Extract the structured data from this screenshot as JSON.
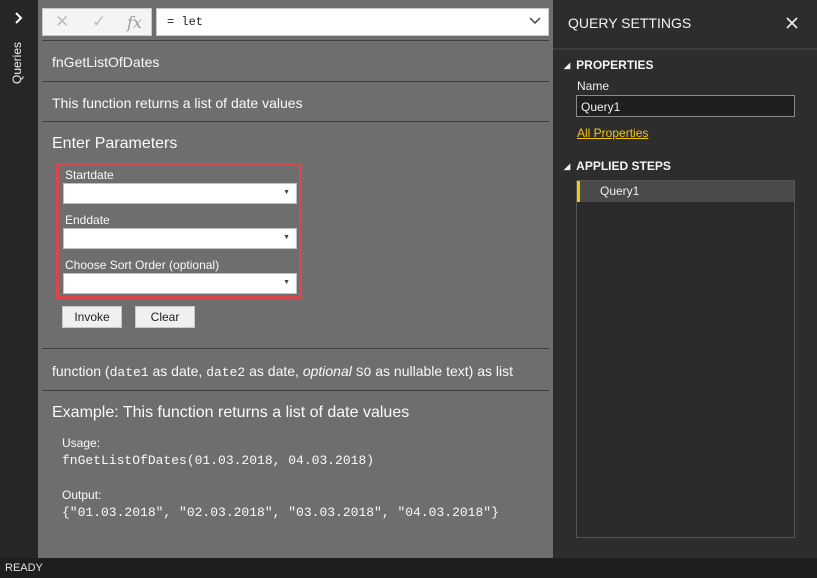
{
  "rail": {
    "expand_icon": "chevron-right-icon",
    "queries_label": "Queries"
  },
  "formula_bar": {
    "cancel_icon": "close-icon",
    "commit_icon": "check-icon",
    "fx_icon": "fx",
    "value": "= let"
  },
  "function": {
    "name": "fnGetListOfDates",
    "description": "This function returns a list of date values"
  },
  "parameters": {
    "title": "Enter Parameters",
    "fields": [
      {
        "label": "Startdate",
        "value": ""
      },
      {
        "label": "Enddate",
        "value": ""
      },
      {
        "label": "Choose Sort Order (optional)",
        "value": ""
      }
    ],
    "invoke_label": "Invoke",
    "clear_label": "Clear"
  },
  "signature": {
    "prefix": "function (",
    "p1": "date1",
    "t1": " as date, ",
    "p2": "date2",
    "t2": " as date, ",
    "optional": "optional",
    "p3": "SO",
    "t3": " as nullable text) as list"
  },
  "example": {
    "title": "Example: This function returns a list of date values",
    "usage_label": "Usage:",
    "usage_code": "fnGetListOfDates(01.03.2018, 04.03.2018)",
    "output_label": "Output:",
    "output_code": "{\"01.03.2018\", \"02.03.2018\", \"03.03.2018\", \"04.03.2018\"}"
  },
  "settings": {
    "title": "QUERY SETTINGS",
    "properties_header": "PROPERTIES",
    "name_label": "Name",
    "name_value": "Query1",
    "all_properties": "All Properties",
    "applied_steps_header": "APPLIED STEPS",
    "steps": [
      "Query1"
    ]
  },
  "status": {
    "text": "READY"
  },
  "colors": {
    "accent_yellow": "#f2c811",
    "highlight_red": "#d7474d",
    "main_panel": "#6e6e6e",
    "dark_panel": "#2d2d2d"
  }
}
